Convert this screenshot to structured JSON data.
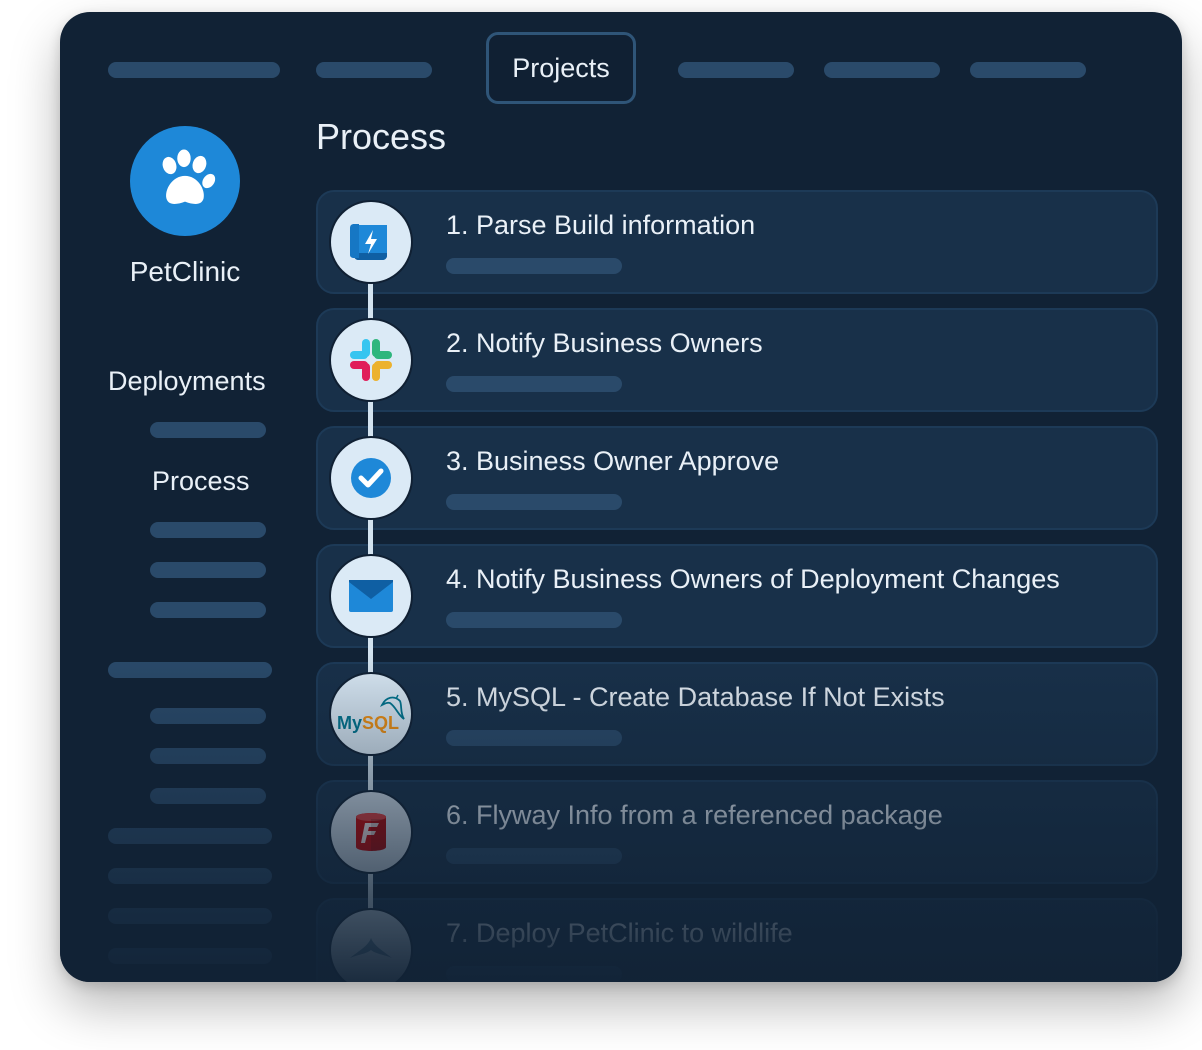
{
  "header": {
    "projects_tab": "Projects"
  },
  "app": {
    "name": "PetClinic"
  },
  "sidebar": {
    "deployments": "Deployments",
    "process": "Process"
  },
  "main": {
    "title": "Process",
    "steps": [
      {
        "label": "1. Parse Build information",
        "icon": "build-info-scroll-icon"
      },
      {
        "label": "2. Notify Business Owners",
        "icon": "slack-icon"
      },
      {
        "label": "3. Business Owner Approve",
        "icon": "checkmark-icon"
      },
      {
        "label": "4. Notify Business Owners of Deployment Changes",
        "icon": "email-icon"
      },
      {
        "label": "5. MySQL - Create Database If Not Exists",
        "icon": "mysql-icon"
      },
      {
        "label": "6. Flyway Info from a referenced package",
        "icon": "flyway-icon"
      },
      {
        "label": "7. Deploy PetClinic to wildlife",
        "icon": "wildfly-icon"
      }
    ]
  },
  "icon_labels": {
    "mysql": "MySQL"
  },
  "colors": {
    "background": "#112235",
    "card": "#183049",
    "placeholder_bar": "#2a4a6a",
    "accent": "#1e88d8",
    "text": "#e9f0f7"
  }
}
